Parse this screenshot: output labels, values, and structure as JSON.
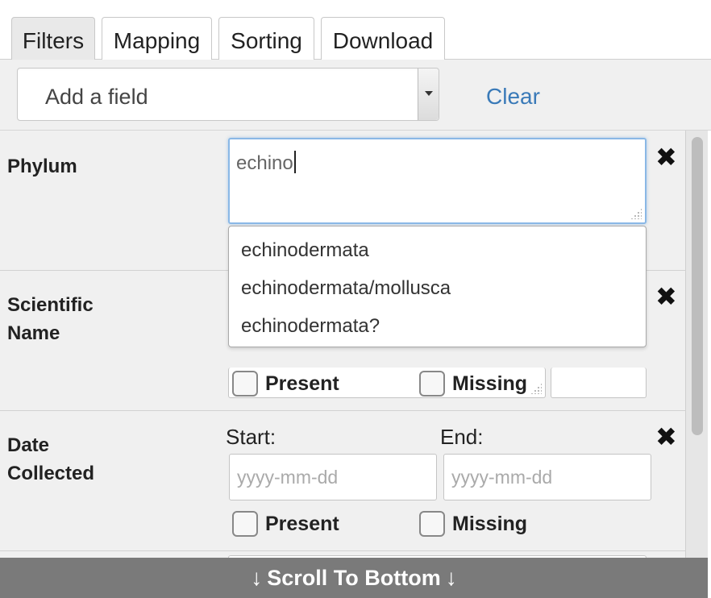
{
  "tabs": [
    "Filters",
    "Mapping",
    "Sorting",
    "Download"
  ],
  "toolbar": {
    "add_field_placeholder": "Add a field",
    "clear_label": "Clear"
  },
  "filters": {
    "phylum": {
      "label": "Phylum",
      "value": "echino"
    },
    "scientific_name": {
      "label_line1": "Scientific",
      "label_line2": "Name",
      "present_label": "Present",
      "missing_label": "Missing"
    },
    "date_collected": {
      "label_line1": "Date",
      "label_line2": "Collected",
      "start_label": "Start:",
      "end_label": "End:",
      "start_placeholder": "yyyy-mm-dd",
      "end_placeholder": "yyyy-mm-dd",
      "present_label": "Present",
      "missing_label": "Missing"
    }
  },
  "autocomplete": [
    "echinodermata",
    "echinodermata/mollusca",
    "echinodermata?"
  ],
  "remove_icon": "✖",
  "scroll_bottom": {
    "label": "Scroll To Bottom",
    "arrow": "↓"
  }
}
